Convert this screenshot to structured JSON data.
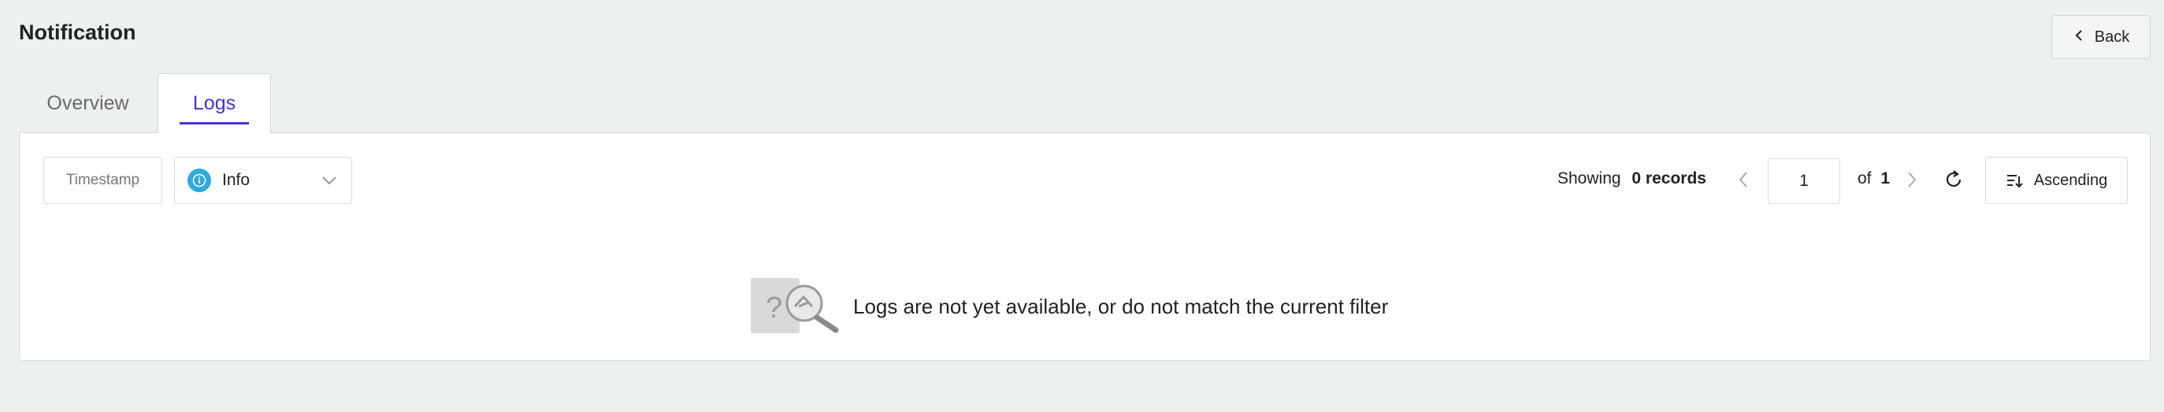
{
  "header": {
    "title": "Notification",
    "back_label": "Back"
  },
  "tabs": [
    {
      "label": "Overview",
      "active": false
    },
    {
      "label": "Logs",
      "active": true
    }
  ],
  "filters": {
    "timestamp_label": "Timestamp",
    "level_value": "Info"
  },
  "pagination": {
    "showing_label": "Showing",
    "records_text": "0 records",
    "current_page": "1",
    "of_label": "of",
    "total_pages": "1"
  },
  "sort": {
    "label": "Ascending"
  },
  "empty_state": {
    "message": "Logs are not yet available, or do not match the current filter"
  },
  "colors": {
    "accent": "#4a2fd6",
    "info": "#2eaadc",
    "background": "#edf0f1"
  },
  "icons": [
    "chevron-left-icon",
    "info-icon",
    "chevron-down-icon",
    "chevron-right-icon",
    "refresh-icon",
    "sort-ascending-icon",
    "empty-search-illustration"
  ]
}
